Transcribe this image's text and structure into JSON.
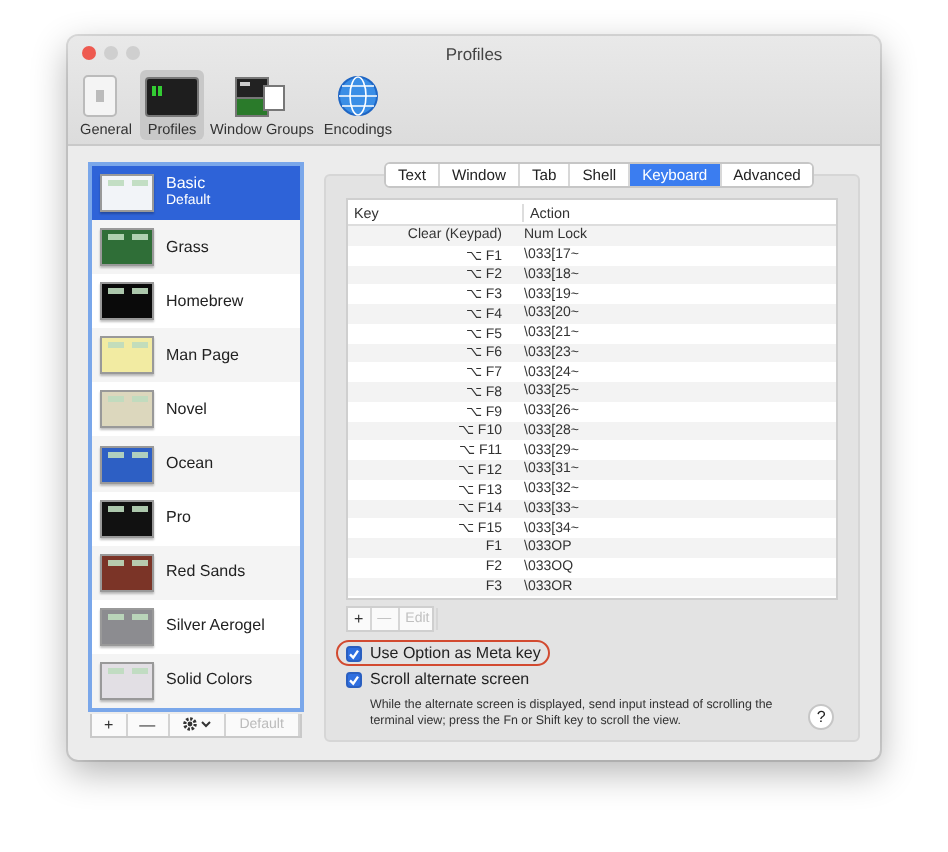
{
  "window": {
    "title": "Profiles"
  },
  "toolbar": [
    {
      "label": "General",
      "selected": false,
      "kind": "general"
    },
    {
      "label": "Profiles",
      "selected": true,
      "kind": "profiles"
    },
    {
      "label": "Window Groups",
      "selected": false,
      "kind": "groups"
    },
    {
      "label": "Encodings",
      "selected": false,
      "kind": "encodings"
    }
  ],
  "profiles": [
    {
      "name": "Basic",
      "note": "Default",
      "selected": true,
      "color": "#f2f4f8"
    },
    {
      "name": "Grass",
      "selected": false,
      "color": "#2f6e37"
    },
    {
      "name": "Homebrew",
      "selected": false,
      "color": "#0a0a0a"
    },
    {
      "name": "Man Page",
      "selected": false,
      "color": "#f2eba2"
    },
    {
      "name": "Novel",
      "selected": false,
      "color": "#dcd7bd"
    },
    {
      "name": "Ocean",
      "selected": false,
      "color": "#2d5fc4"
    },
    {
      "name": "Pro",
      "selected": false,
      "color": "#111111"
    },
    {
      "name": "Red Sands",
      "selected": false,
      "color": "#7b3427"
    },
    {
      "name": "Silver Aerogel",
      "selected": false,
      "color": "#8c8c90"
    },
    {
      "name": "Solid Colors",
      "selected": false,
      "color": "#e2dfe4"
    }
  ],
  "profile_buttons": [
    {
      "kind": "text",
      "label": "+",
      "disabled": false
    },
    {
      "kind": "text",
      "label": "—",
      "disabled": false
    },
    {
      "kind": "gear",
      "disabled": false
    },
    {
      "kind": "text",
      "label": "Default",
      "disabled": true
    }
  ],
  "tabs": [
    {
      "label": "Text",
      "selected": false
    },
    {
      "label": "Window",
      "selected": false
    },
    {
      "label": "Tab",
      "selected": false
    },
    {
      "label": "Shell",
      "selected": false
    },
    {
      "label": "Keyboard",
      "selected": true
    },
    {
      "label": "Advanced",
      "selected": false
    }
  ],
  "table": {
    "columns": [
      "Key",
      "Action"
    ],
    "rows": [
      [
        "Clear (Keypad)",
        "Num Lock"
      ],
      [
        "⌥ F1",
        "\\033[17~"
      ],
      [
        "⌥ F2",
        "\\033[18~"
      ],
      [
        "⌥ F3",
        "\\033[19~"
      ],
      [
        "⌥ F4",
        "\\033[20~"
      ],
      [
        "⌥ F5",
        "\\033[21~"
      ],
      [
        "⌥ F6",
        "\\033[23~"
      ],
      [
        "⌥ F7",
        "\\033[24~"
      ],
      [
        "⌥ F8",
        "\\033[25~"
      ],
      [
        "⌥ F9",
        "\\033[26~"
      ],
      [
        "⌥ F10",
        "\\033[28~"
      ],
      [
        "⌥ F11",
        "\\033[29~"
      ],
      [
        "⌥ F12",
        "\\033[31~"
      ],
      [
        "⌥ F13",
        "\\033[32~"
      ],
      [
        "⌥ F14",
        "\\033[33~"
      ],
      [
        "⌥ F15",
        "\\033[34~"
      ],
      [
        "F1",
        "\\033OP"
      ],
      [
        "F2",
        "\\033OQ"
      ],
      [
        "F3",
        "\\033OR"
      ]
    ]
  },
  "table_buttons": [
    {
      "label": "+",
      "disabled": false
    },
    {
      "label": "—",
      "disabled": true
    },
    {
      "label": "Edit",
      "disabled": true
    }
  ],
  "options": [
    {
      "label": "Use Option as Meta key",
      "checked": true,
      "highlighted": true
    },
    {
      "label": "Scroll alternate screen",
      "checked": true,
      "highlighted": false
    }
  ],
  "description": "While the alternate screen is displayed, send input instead of scrolling the terminal view; press the Fn or Shift key to scroll the view.",
  "help": "?"
}
